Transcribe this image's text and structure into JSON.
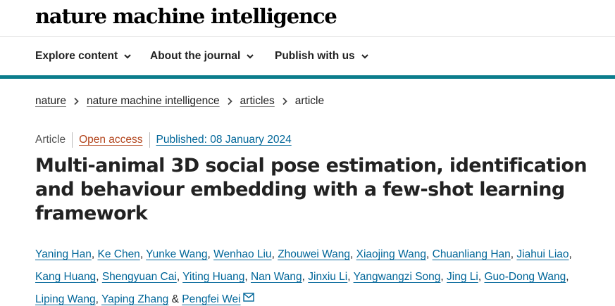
{
  "site": {
    "logo": "nature machine intelligence"
  },
  "nav": {
    "items": [
      {
        "label": "Explore content"
      },
      {
        "label": "About the journal"
      },
      {
        "label": "Publish with us"
      }
    ]
  },
  "breadcrumb": {
    "items": [
      "nature",
      "nature machine intelligence",
      "articles"
    ],
    "current": "article"
  },
  "article": {
    "type": "Article",
    "access": "Open access",
    "published": "Published: 08 January 2024",
    "title": "Multi-animal 3D social pose estimation, identification and behaviour embedding with a few-shot learning framework",
    "authors": [
      "Yaning Han",
      "Ke Chen",
      "Yunke Wang",
      "Wenhao Liu",
      "Zhouwei Wang",
      "Xiaojing Wang",
      "Chuanliang Han",
      "Jiahui Liao",
      "Kang Huang",
      "Shengyuan Cai",
      "Yiting Huang",
      "Nan Wang",
      "Jinxiu Li",
      "Yangwangzi Song",
      "Jing Li",
      "Guo-Dong Wang",
      "Liping Wang",
      "Yaping Zhang",
      "Pengfei Wei"
    ],
    "author_separator": ", ",
    "author_final_separator": " & ",
    "corresponding_icon": "mail-icon"
  },
  "colors": {
    "accent_bar": "#0b7d8c",
    "link": "#006699",
    "open_access": "#b3461e",
    "text": "#222222"
  }
}
